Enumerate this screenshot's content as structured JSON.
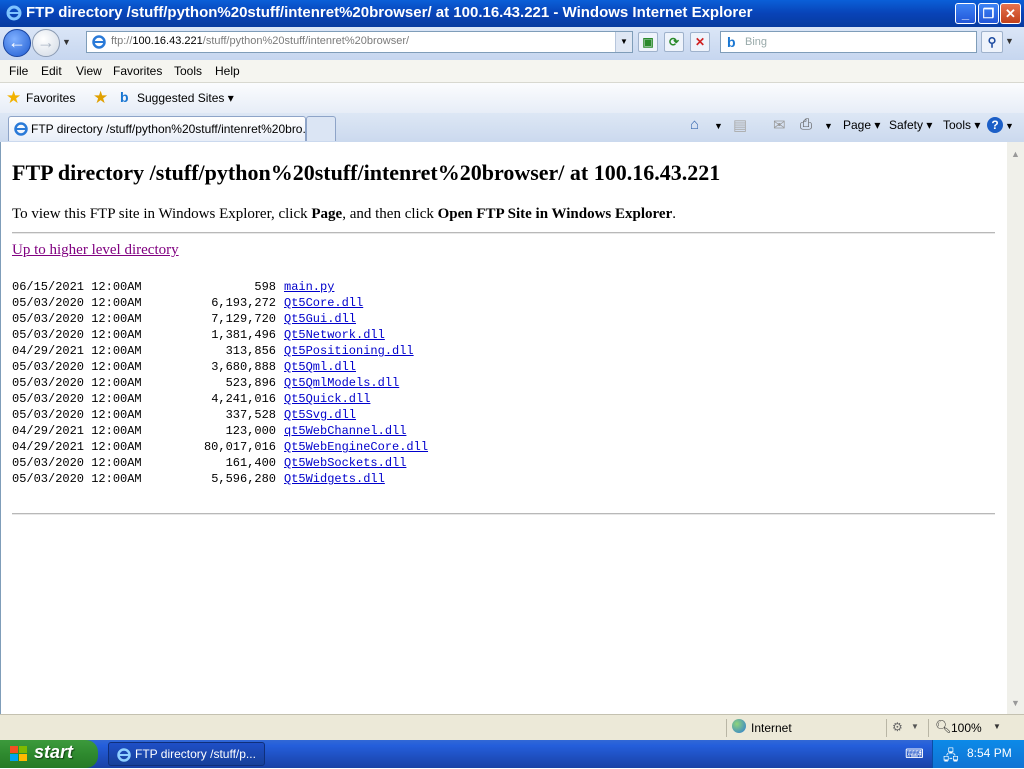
{
  "window": {
    "title": "FTP directory /stuff/python%20stuff/intenret%20browser/ at 100.16.43.221 - Windows Internet Explorer",
    "minimize": "_",
    "restore": "❐",
    "close": "✕"
  },
  "address": {
    "prefix": "ftp://",
    "host": "100.16.43.221",
    "path": "/stuff/python%20stuff/intenret%20browser/"
  },
  "search": {
    "placeholder": "Bing"
  },
  "menu": [
    "File",
    "Edit",
    "View",
    "Favorites",
    "Tools",
    "Help"
  ],
  "favorites_bar": {
    "favorites_label": "Favorites",
    "suggested_label": "Suggested Sites ▾"
  },
  "tab": {
    "title": "FTP directory /stuff/python%20stuff/intenret%20bro..."
  },
  "command_bar": {
    "page": "Page ▾",
    "safety": "Safety ▾",
    "tools": "Tools ▾"
  },
  "page": {
    "heading": "FTP directory /stuff/python%20stuff/intenret%20browser/ at 100.16.43.221",
    "instr_pre": "To view this FTP site in Windows Explorer, click ",
    "instr_page": "Page",
    "instr_mid": ", and then click ",
    "instr_open": "Open FTP Site in Windows Explorer",
    "instr_end": ".",
    "up_link": "Up to higher level directory",
    "files": [
      {
        "date": "06/15/2021 12:00AM",
        "size": "598",
        "name": "main.py"
      },
      {
        "date": "05/03/2020 12:00AM",
        "size": "6,193,272",
        "name": "Qt5Core.dll"
      },
      {
        "date": "05/03/2020 12:00AM",
        "size": "7,129,720",
        "name": "Qt5Gui.dll"
      },
      {
        "date": "05/03/2020 12:00AM",
        "size": "1,381,496",
        "name": "Qt5Network.dll"
      },
      {
        "date": "04/29/2021 12:00AM",
        "size": "313,856",
        "name": "Qt5Positioning.dll"
      },
      {
        "date": "05/03/2020 12:00AM",
        "size": "3,680,888",
        "name": "Qt5Qml.dll"
      },
      {
        "date": "05/03/2020 12:00AM",
        "size": "523,896",
        "name": "Qt5QmlModels.dll"
      },
      {
        "date": "05/03/2020 12:00AM",
        "size": "4,241,016",
        "name": "Qt5Quick.dll"
      },
      {
        "date": "05/03/2020 12:00AM",
        "size": "337,528",
        "name": "Qt5Svg.dll"
      },
      {
        "date": "04/29/2021 12:00AM",
        "size": "123,000",
        "name": "qt5WebChannel.dll"
      },
      {
        "date": "04/29/2021 12:00AM",
        "size": "80,017,016",
        "name": "Qt5WebEngineCore.dll"
      },
      {
        "date": "05/03/2020 12:00AM",
        "size": "161,400",
        "name": "Qt5WebSockets.dll"
      },
      {
        "date": "05/03/2020 12:00AM",
        "size": "5,596,280",
        "name": "Qt5Widgets.dll"
      }
    ]
  },
  "status": {
    "zone": "Internet",
    "zoom": "100%"
  },
  "taskbar": {
    "start": "start",
    "item": "FTP directory /stuff/p...",
    "clock": "8:54 PM"
  },
  "colors": {
    "link": "#0000cc",
    "visited": "#800080",
    "titlebar": "#0843b7"
  }
}
